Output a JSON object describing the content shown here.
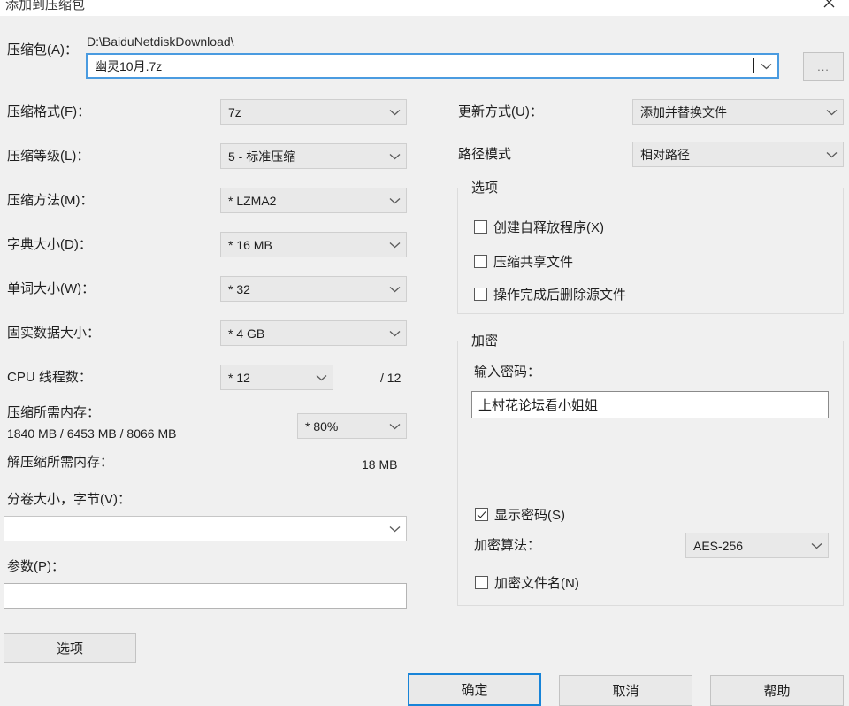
{
  "window": {
    "title": "添加到压缩包",
    "close_icon": "close-icon"
  },
  "archive": {
    "label": "压缩包(A)：",
    "path": "D:\\BaiduNetdiskDownload\\",
    "filename": "幽灵10月.7z",
    "browse_label": "..."
  },
  "left": {
    "format": {
      "label": "压缩格式(F)：",
      "value": "7z"
    },
    "level": {
      "label": "压缩等级(L)：",
      "value": "5 - 标准压缩"
    },
    "method": {
      "label": "压缩方法(M)：",
      "value": "*  LZMA2"
    },
    "dictionary": {
      "label": "字典大小(D)：",
      "value": "*  16 MB"
    },
    "word": {
      "label": "单词大小(W)：",
      "value": "*  32"
    },
    "solid": {
      "label": "固实数据大小：",
      "value": "*  4 GB"
    },
    "threads": {
      "label": "CPU 线程数：",
      "value": "*  12",
      "total": "/ 12"
    },
    "mem_compress": {
      "label": "压缩所需内存：",
      "value": "1840 MB / 6453 MB / 8066 MB",
      "percent": "*  80%"
    },
    "mem_decompress": {
      "label": "解压缩所需内存：",
      "value": "18 MB"
    },
    "volume": {
      "label": "分卷大小，字节(V)：",
      "value": ""
    },
    "parameters": {
      "label": "参数(P)：",
      "value": ""
    }
  },
  "right": {
    "update_mode": {
      "label": "更新方式(U)：",
      "value": "添加并替换文件"
    },
    "path_mode": {
      "label": "路径模式",
      "value": "相对路径"
    },
    "options": {
      "title": "选项",
      "items": [
        {
          "label": "创建自释放程序(X)",
          "checked": false
        },
        {
          "label": "压缩共享文件",
          "checked": false
        },
        {
          "label": "操作完成后删除源文件",
          "checked": false
        }
      ]
    },
    "encryption": {
      "title": "加密",
      "password_label": "输入密码：",
      "password_value": "上村花论坛看小姐姐",
      "show_password": {
        "label": "显示密码(S)",
        "checked": true
      },
      "algorithm_label": "加密算法：",
      "algorithm_value": "AES-256",
      "encrypt_names": {
        "label": "加密文件名(N)",
        "checked": false
      }
    }
  },
  "footer": {
    "options_button": "选项",
    "ok_button": "确定",
    "cancel_button": "取消",
    "help_button": "帮助"
  },
  "colors": {
    "dialog_bg": "#f0f0f0",
    "combo_bg": "#e9e9e9",
    "focus_blue": "#4a9be0",
    "default_blue": "#1884d8"
  }
}
